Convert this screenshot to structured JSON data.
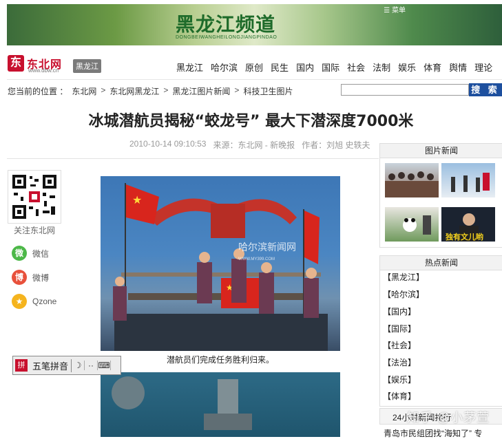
{
  "banner": {
    "title": "黑龙江频道",
    "subtitle": "DONGBEIWANGHEILONGJIANGPINDAO",
    "menu_icon": "menu-icon",
    "menu_label": "菜单"
  },
  "site": {
    "logo_glyph": "东",
    "logo_name": "东北网",
    "logo_url": "www.dbw.cn",
    "channel_tag": "黑龙江"
  },
  "nav": {
    "items": [
      "黑龙江",
      "哈尔滨",
      "原创",
      "民生",
      "国内",
      "国际",
      "社会",
      "法制",
      "娱乐",
      "体育",
      "舆情",
      "理论"
    ]
  },
  "breadcrumb": {
    "prefix": "您当前的位置 ：",
    "items": [
      "东北网",
      "东北网黑龙江",
      "黑龙江图片新闻",
      "科技卫生图片"
    ],
    "separator": ">"
  },
  "search": {
    "placeholder": "",
    "button": "搜 索"
  },
  "article": {
    "title": "冰城潜航员揭秘“蛟龙号” 最大下潜深度7000米",
    "datetime": "2010-10-14 09:10:53",
    "source": "来源：东北网 - 新晚报",
    "author": "作者：刘旭 史轶夫",
    "photo_caption": "潜航员们完成任务胜利归来。",
    "photo_watermark": "哈尔滨新闻网",
    "photo_watermark_url": "WWW.MY399.COM"
  },
  "share": {
    "qr_label": "关注东北网",
    "items": [
      {
        "label": "微信",
        "icon": "wechat-icon",
        "color": "#4cb848",
        "glyph": "微"
      },
      {
        "label": "微博",
        "icon": "weibo-icon",
        "color": "#e8513c",
        "glyph": "博"
      },
      {
        "label": "Qzone",
        "icon": "qzone-icon",
        "color": "#f5b41e",
        "glyph": "★"
      }
    ]
  },
  "ime": {
    "logo": "拼",
    "label": "五笔拼音",
    "moon_icon": "☽",
    "dots": "··",
    "kbd": "⌨"
  },
  "sidebar": {
    "photo_news_title": "图片新闻",
    "thumb_caption": "独有文儿哟",
    "hot_news_title": "热点新闻",
    "hot_categories": [
      "【黑龙江】",
      "【哈尔滨】",
      "【国内】",
      "【国际】",
      "【社会】",
      "【法治】",
      "【娱乐】",
      "【体育】"
    ],
    "ranking_title": "24小时新闻排行",
    "bottom_item": "青岛市民组团找“海知了” 专"
  },
  "watermark": "知乎 @小茅萱",
  "colors": {
    "accent_red": "#c8102e",
    "search_blue": "#1d4f9e",
    "banner_green": "#1e6b2a"
  }
}
